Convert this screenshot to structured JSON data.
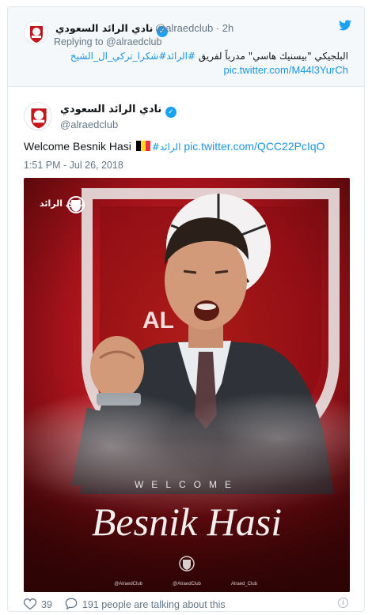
{
  "parent_tweet": {
    "display_name": "نادي الرائد السعودي",
    "handle": "@alraedclub",
    "time": "2h",
    "replying_prefix": "Replying to",
    "replying_to": "@alraedclub",
    "text_plain": "البلجيكي \"بيسنيك هاسي\" مدرباً لفريق",
    "text_tags": "#الرائد#شكرا_تركي_ال_الشيخ",
    "link": "pic.twitter.com/M44l3YurCh"
  },
  "main_tweet": {
    "display_name": "نادي الرائد السعودي",
    "handle": "@alraedclub",
    "text_prefix": "Welcome Besnik Hasi",
    "hashtag": "#الرائد",
    "link": "pic.twitter.com/QCC22PcIqO",
    "timestamp": "1:51 PM - Jul 26, 2018",
    "poster": {
      "club_wordmark": "نادي الرائد",
      "welcome": "WELCOME",
      "name": "Besnik Hasi",
      "socials": [
        "@AlraedClub",
        "@AlraedClub",
        "Alraed_Club"
      ]
    }
  },
  "engagement": {
    "likes": "39",
    "talking": "191 people are talking about this"
  },
  "colors": {
    "link": "#1b95e0",
    "verified": "#1da1f2",
    "poster_red": "#c4161c"
  },
  "icons": [
    "twitter-bird-icon",
    "verified-badge-icon",
    "heart-icon",
    "comment-icon",
    "info-icon"
  ]
}
